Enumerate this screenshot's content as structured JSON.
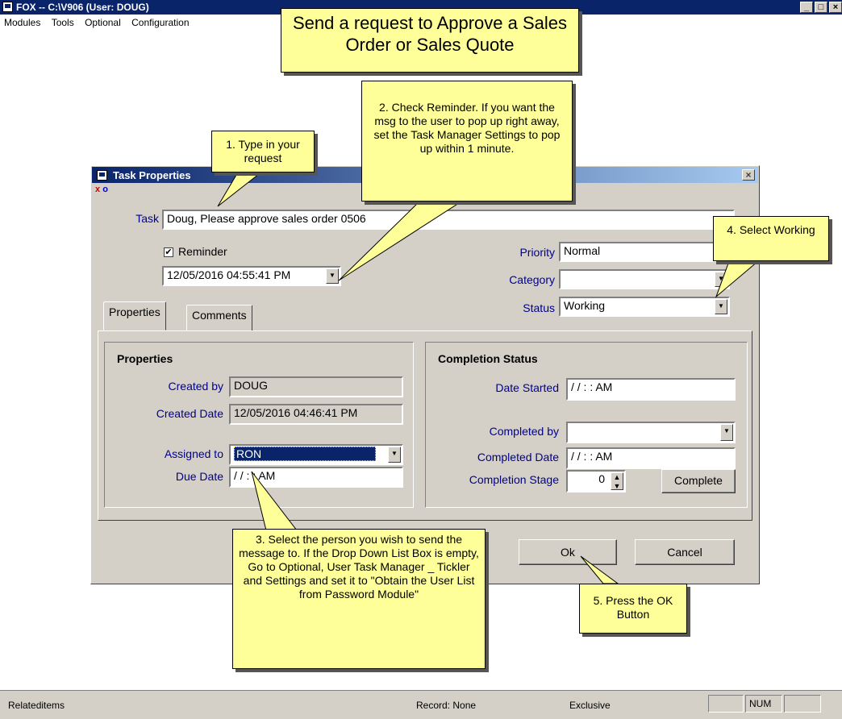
{
  "window": {
    "title": "FOX -- C:\\V906  (User: DOUG)",
    "buttons": [
      "_",
      "□",
      "×"
    ]
  },
  "menu": [
    "Modules",
    "Tools",
    "Optional",
    "Configuration"
  ],
  "dialog": {
    "title": "Task Properties",
    "close": "×",
    "mini_icons": [
      "x",
      "o"
    ],
    "task_label": "Task",
    "task_value": "Doug, Please approve sales order 0506",
    "reminder_label": "Reminder",
    "reminder_checked": "✔",
    "reminder_datetime": "12/05/2016 04:55:41 PM",
    "priority_label": "Priority",
    "priority_value": "Normal",
    "category_label": "Category",
    "category_value": "",
    "status_label": "Status",
    "status_value": "Working",
    "tabs": [
      "Properties",
      "Comments"
    ],
    "properties": {
      "heading": "Properties",
      "created_by_label": "Created by",
      "created_by_value": "DOUG",
      "created_date_label": "Created Date",
      "created_date_value": "12/05/2016 04:46:41 PM",
      "assigned_to_label": "Assigned to",
      "assigned_to_value": "RON",
      "due_date_label": "Due Date",
      "due_date_value": "/ /    : :  AM"
    },
    "completion": {
      "heading": "Completion Status",
      "date_started_label": "Date Started",
      "date_started_value": "/ /    : :  AM",
      "completed_by_label": "Completed by",
      "completed_by_value": "",
      "completed_date_label": "Completed Date",
      "completed_date_value": "/ /    : :  AM",
      "stage_label": "Completion Stage",
      "stage_value": "0",
      "complete_button": "Complete"
    },
    "ok_button": "Ok",
    "cancel_button": "Cancel"
  },
  "callouts": {
    "main": "Send a request to Approve a Sales Order or Sales Quote",
    "step1": "1. Type in your request",
    "step2": "2. Check Reminder.  If you want the msg to the user to pop up right away, set the Task Manager Settings to pop up within 1 minute.",
    "step3": "3. Select the person you wish to send the message to.  If the Drop Down List Box is empty, Go to Optional, User Task Manager _ Tickler and Settings and set it to \"Obtain the User List from Password Module\"",
    "step4": "4. Select Working",
    "step5": "5. Press the OK Button"
  },
  "statusbar": {
    "left": "Relateditems",
    "record": "Record: None",
    "mode": "Exclusive",
    "num": "NUM"
  },
  "colors": {
    "titlebar": "#0a246a",
    "dialog_bg": "#d4d0c8",
    "callout_bg": "#ffff99",
    "label_blue": "#00008b",
    "selection": "#0a246a"
  }
}
